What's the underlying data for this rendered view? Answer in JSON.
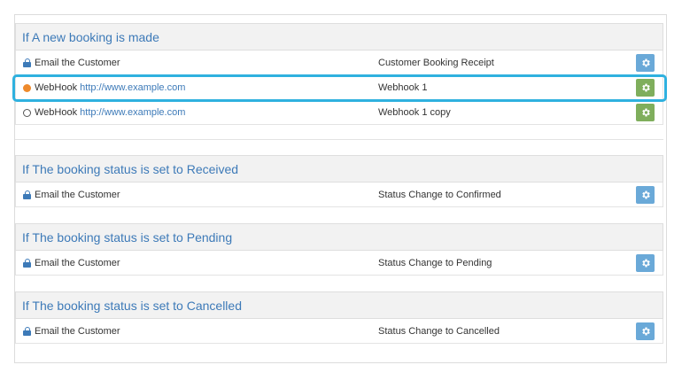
{
  "colors": {
    "accent": "#3d7ab8",
    "highlight": "#2fb1df",
    "dot_active": "#ee8a2c",
    "button_blue": "#6aa9d8",
    "button_green": "#7fae5c"
  },
  "sections": [
    {
      "title": "If A new booking is made",
      "rows": [
        {
          "icon": "lock-icon",
          "type": "Email the Customer",
          "url": "",
          "template": "Customer Booking Receipt",
          "button_color": "blue"
        },
        {
          "icon": "orange-dot-icon",
          "type": "WebHook",
          "url": "http://www.example.com",
          "template": "Webhook 1",
          "button_color": "green",
          "highlighted": true
        },
        {
          "icon": "empty-circle-icon",
          "type": "WebHook",
          "url": "http://www.example.com",
          "template": "Webhook 1 copy",
          "button_color": "green"
        }
      ]
    },
    {
      "title": "If The booking status is set to Received",
      "rows": [
        {
          "icon": "lock-icon",
          "type": "Email the Customer",
          "url": "",
          "template": "Status Change to Confirmed",
          "button_color": "blue"
        }
      ]
    },
    {
      "title": "If The booking status is set to Pending",
      "rows": [
        {
          "icon": "lock-icon",
          "type": "Email the Customer",
          "url": "",
          "template": "Status Change to Pending",
          "button_color": "blue"
        }
      ]
    },
    {
      "title": "If The booking status is set to Cancelled",
      "rows": [
        {
          "icon": "lock-icon",
          "type": "Email the Customer",
          "url": "",
          "template": "Status Change to Cancelled",
          "button_color": "blue"
        }
      ]
    }
  ]
}
